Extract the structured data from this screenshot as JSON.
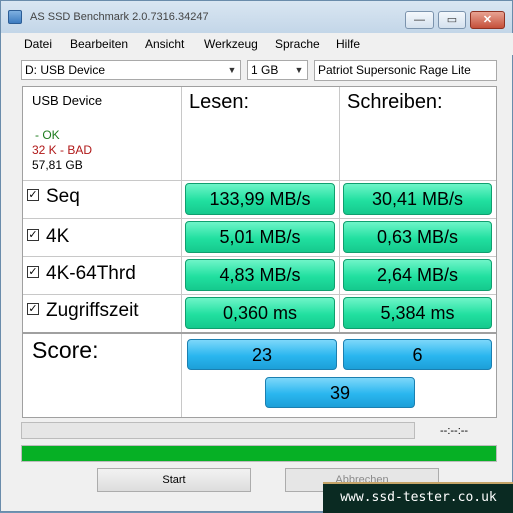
{
  "window": {
    "title": "AS SSD Benchmark 2.0.7316.34247",
    "controls": {
      "minimize": "—",
      "maximize": "▭",
      "close": "✕"
    }
  },
  "menu": [
    "Datei",
    "Bearbeiten",
    "Ansicht",
    "Werkzeug",
    "Sprache",
    "Hilfe"
  ],
  "toolbar": {
    "drive_select": "D: USB Device",
    "size_select": "1 GB",
    "device_name": "Patriot Supersonic Rage Lite"
  },
  "drive_info": {
    "name": "USB Device",
    "status": "- OK",
    "alignment": "32 K - BAD",
    "capacity": "57,81 GB"
  },
  "columns": {
    "read": "Lesen:",
    "write": "Schreiben:"
  },
  "rows": [
    {
      "label": "Seq",
      "checked": true,
      "read": "133,99 MB/s",
      "write": "30,41 MB/s"
    },
    {
      "label": "4K",
      "checked": true,
      "read": "5,01 MB/s",
      "write": "0,63 MB/s"
    },
    {
      "label": "4K-64Thrd",
      "checked": true,
      "read": "4,83 MB/s",
      "write": "2,64 MB/s"
    },
    {
      "label": "Zugriffszeit",
      "checked": true,
      "read": "0,360 ms",
      "write": "5,384 ms"
    }
  ],
  "score": {
    "label": "Score:",
    "read": "23",
    "write": "6",
    "total": "39"
  },
  "progress": {
    "top_fraction": 0.0,
    "bottom_fraction": 1.0,
    "timer": "--:--:--"
  },
  "buttons": {
    "start": "Start",
    "abort": "Abbrechen"
  },
  "watermark": "www.ssd-tester.co.uk",
  "colors": {
    "result_green": "#21e0a0",
    "score_blue": "#2ab6ef",
    "progress_green": "#06b025"
  }
}
